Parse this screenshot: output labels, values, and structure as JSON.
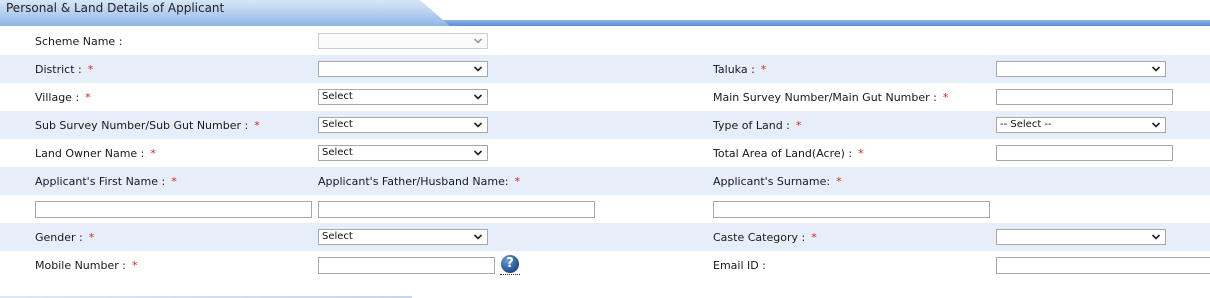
{
  "section": {
    "title": "Personal & Land Details of Applicant"
  },
  "fields": {
    "scheme_name": {
      "label": "Scheme Name :",
      "value": ""
    },
    "district": {
      "label": "District :",
      "req": "*",
      "value": ""
    },
    "taluka": {
      "label": "Taluka :",
      "req": "*",
      "value": ""
    },
    "village": {
      "label": "Village :",
      "req": "*",
      "value": "Select"
    },
    "main_survey": {
      "label": "Main Survey Number/Main Gut Number :",
      "req": "*",
      "value": ""
    },
    "sub_survey": {
      "label": "Sub Survey Number/Sub Gut Number :",
      "req": "*",
      "value": "Select"
    },
    "type_of_land": {
      "label": "Type of Land :",
      "req": "*",
      "value": "-- Select --"
    },
    "land_owner": {
      "label": "Land Owner Name :",
      "req": "*",
      "value": "Select"
    },
    "total_area": {
      "label": "Total Area of Land(Acre) :",
      "req": "*",
      "value": ""
    },
    "first_name": {
      "label": "Applicant's First Name :",
      "req": "*",
      "value": ""
    },
    "father_name": {
      "label": "Applicant's Father/Husband Name:",
      "req": "*",
      "value": ""
    },
    "surname": {
      "label": "Applicant's Surname:",
      "req": "*",
      "value": ""
    },
    "gender": {
      "label": "Gender :",
      "req": "*",
      "value": "Select"
    },
    "caste": {
      "label": "Caste Category :",
      "req": "*",
      "value": ""
    },
    "mobile": {
      "label": "Mobile Number :",
      "req": "*",
      "value": "",
      "help": "?"
    },
    "email": {
      "label": "Email ID :",
      "value": ""
    }
  },
  "colors": {
    "required": "#e0201c",
    "row_shade": "#e6eefa",
    "header": "#8fb4e3"
  }
}
